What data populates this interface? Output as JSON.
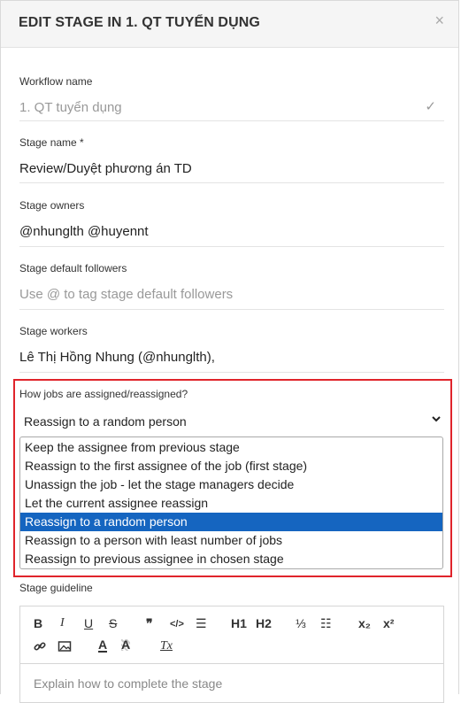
{
  "dialog": {
    "title": "EDIT STAGE IN 1. QT TUYỂN DỤNG",
    "close_glyph": "×"
  },
  "workflow_name": {
    "label": "Workflow name",
    "value": "1. QT tuyển dụng",
    "check_glyph": "✓"
  },
  "stage_name": {
    "label": "Stage name *",
    "value": "Review/Duyệt phương án TD"
  },
  "stage_owners": {
    "label": "Stage owners",
    "value": "@nhunglth @huyennt"
  },
  "stage_default_followers": {
    "label": "Stage default followers",
    "placeholder": "Use @ to tag stage default followers"
  },
  "stage_workers": {
    "label": "Stage workers",
    "value": "Lê Thị Hồng Nhung (@nhunglth),"
  },
  "assignment": {
    "label": "How jobs are assigned/reassigned?",
    "selected": "Reassign to a random person",
    "chevron_glyph": "⌄",
    "options": [
      "Keep the assignee from previous stage",
      "Reassign to the first assignee of the job (first stage)",
      "Unassign the job - let the stage managers decide",
      "Let the current assignee reassign",
      "Reassign to a random person",
      "Reassign to a person with least number of jobs",
      "Reassign to previous assignee in chosen stage"
    ],
    "selected_index": 4,
    "highlight_color": "#e0242b",
    "selected_bg": "#1565c0"
  },
  "stage_guideline": {
    "label": "Stage guideline",
    "placeholder": "Explain how to complete the stage",
    "toolbar": {
      "bold": "B",
      "italic": "I",
      "underline": "U",
      "strike": "S",
      "quote": "❞",
      "code": "</>",
      "align": "☰",
      "h1": "H1",
      "h2": "H2",
      "ordered_list": "⅓",
      "bullet_list": "☷",
      "subscript": "x₂",
      "superscript": "x²",
      "link": "🔗",
      "image": "▣",
      "text_color": "A",
      "highlight": "A",
      "clear_format": "Tx"
    }
  }
}
